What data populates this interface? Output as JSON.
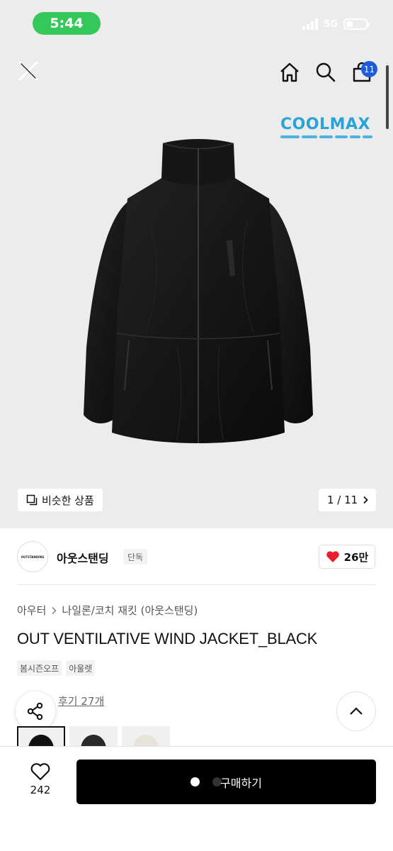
{
  "status_bar": {
    "time": "5:44",
    "network": "5G"
  },
  "header": {
    "cart_count": "11"
  },
  "hero": {
    "badge_text": "COOLMAX",
    "similar_label": "비슷한 상품",
    "pager_text": "1 / 11"
  },
  "brand": {
    "logo_text": "OUTSTANDING",
    "name": "아웃스탠딩",
    "tag": "단독",
    "likes": "26만"
  },
  "breadcrumb": {
    "category": "아우터",
    "subcategory": "나일론/코치 재킷 (아웃스탠딩)"
  },
  "product": {
    "title": "OUT VENTILATIVE WIND JACKET_BLACK",
    "tags": [
      "봄시즌오프",
      "아울렛"
    ],
    "review_link": "후기 27개"
  },
  "bottom": {
    "wish_count": "242",
    "buy_label": "구매하기"
  },
  "colors": {
    "status_green": "#34c759",
    "badge_blue": "#1e5bd8",
    "heart_red": "#e8202e",
    "coolmax_blue": "#2aa3d6"
  }
}
